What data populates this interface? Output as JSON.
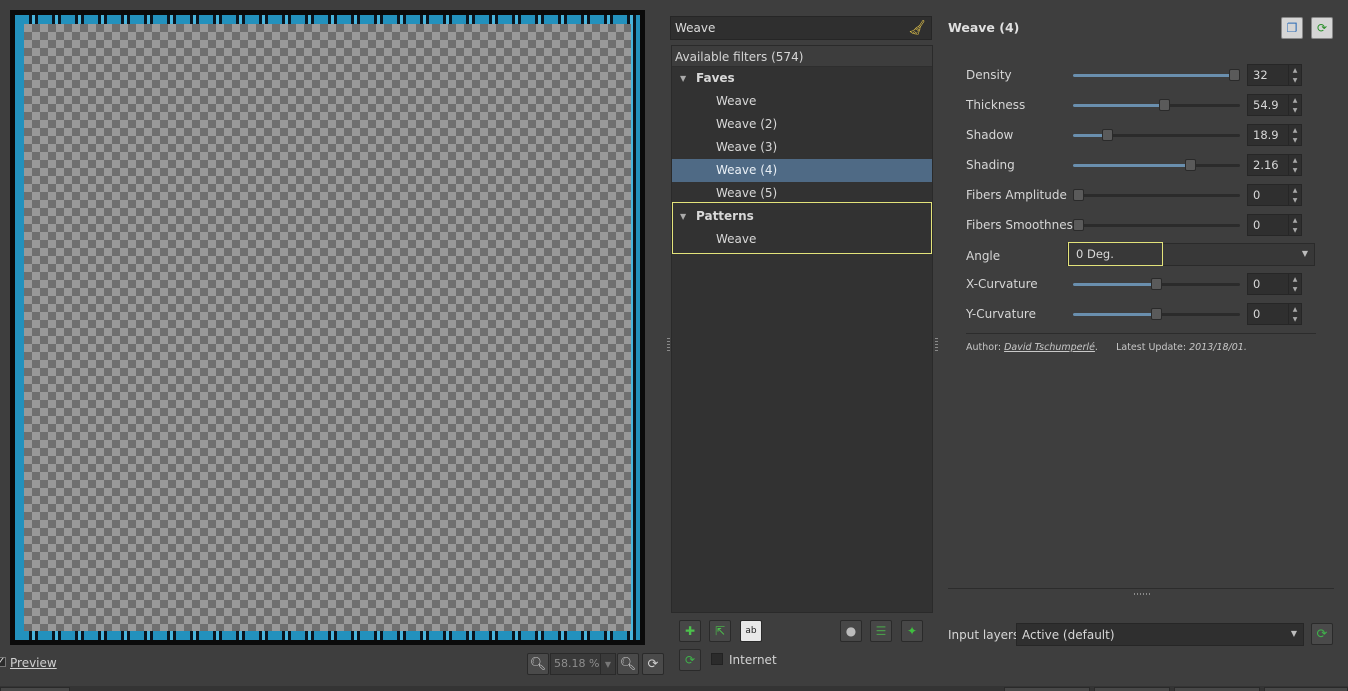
{
  "preview": {
    "checkbox_mark": "✓",
    "label": "Preview",
    "zoom_value": "58.18 %"
  },
  "search": {
    "value": "Weave"
  },
  "tree": {
    "header": "Available filters (574)",
    "categories": [
      {
        "name": "Faves",
        "items": [
          "Weave",
          "Weave (2)",
          "Weave (3)",
          "Weave (4)",
          "Weave (5)"
        ]
      },
      {
        "name": "Patterns",
        "items": [
          "Weave"
        ]
      }
    ],
    "selected": "Weave (4)"
  },
  "internet": {
    "label": "Internet"
  },
  "filter": {
    "title": "Weave (4)",
    "params": [
      {
        "label": "Density",
        "value": "32",
        "fraction": 1.0
      },
      {
        "label": "Thickness",
        "value": "54.9",
        "fraction": 0.549
      },
      {
        "label": "Shadow",
        "value": "18.9",
        "fraction": 0.189
      },
      {
        "label": "Shading",
        "value": "2.16",
        "fraction": 0.72
      },
      {
        "label": "Fibers Amplitude",
        "value": "0",
        "fraction": 0
      },
      {
        "label": "Fibers Smoothness",
        "value": "0",
        "fraction": 0
      }
    ],
    "angle": {
      "label": "Angle",
      "value": "0 Deg."
    },
    "params2": [
      {
        "label": "X-Curvature",
        "value": "0",
        "fraction": 0.5
      },
      {
        "label": "Y-Curvature",
        "value": "0",
        "fraction": 0.5
      }
    ],
    "author_prefix": "Author:",
    "author_name": "David Tschumperlé",
    "update_prefix": "Latest Update:",
    "update_date": "2013/18/01"
  },
  "input_layers": {
    "label": "Input layers",
    "value": "Active (default)"
  },
  "icons": {
    "zoom_out": "zoom-out-icon",
    "zoom_in": "zoom-in-icon",
    "refresh": "refresh-icon",
    "clear": "broom-icon",
    "add_fave": "add-fave-icon",
    "remove_fave": "remove-fave-icon",
    "rename_fave": "rename-fave-icon",
    "update_filters": "globe-icon",
    "toggle_list": "list-icon",
    "expand": "expand-icon",
    "copy": "copy-icon"
  },
  "colors": {
    "selection": "#4f6a85",
    "accent": "#6a8fae",
    "highlight": "#e3e37a"
  }
}
